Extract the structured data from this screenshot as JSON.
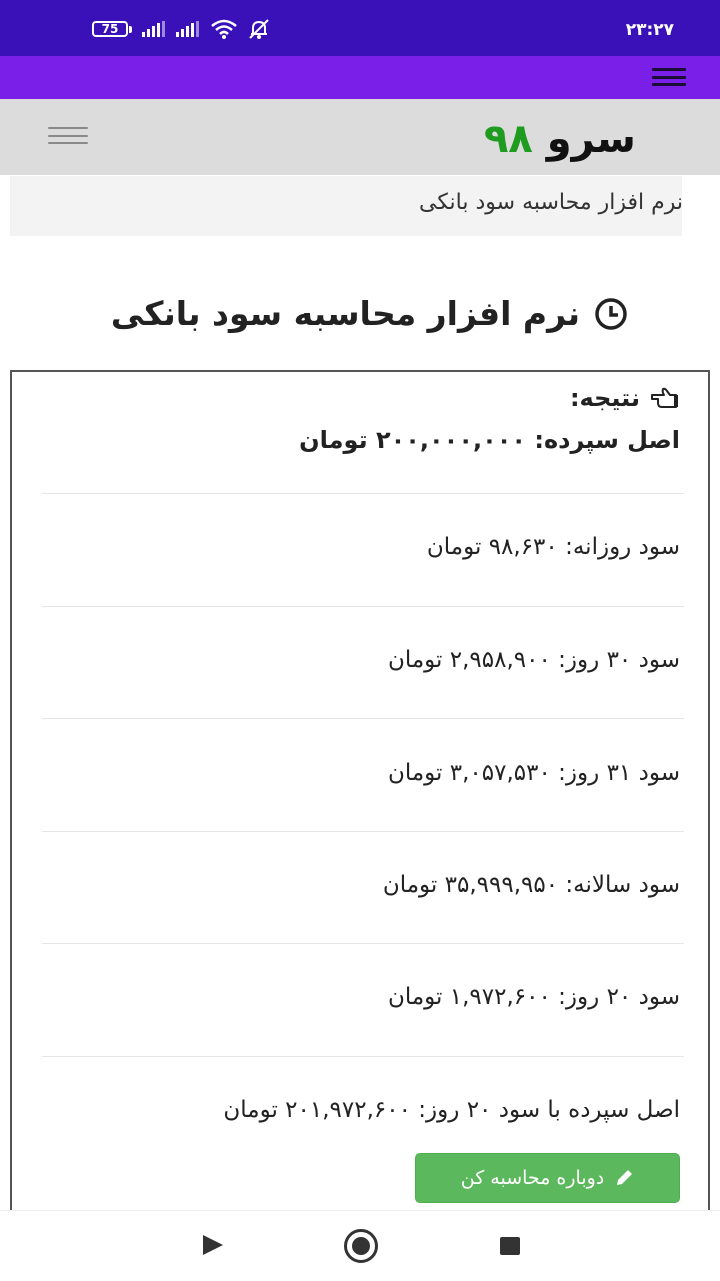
{
  "status_bar": {
    "time": "۲۳:۲۷",
    "battery_level": "75",
    "icons": [
      "battery-icon",
      "signal-icon",
      "signal-icon",
      "wifi-icon",
      "notifications-muted-icon"
    ]
  },
  "header": {
    "logo_word": "سرو",
    "logo_number": "۹۸",
    "logo_number_color": "#1f9b1f"
  },
  "breadcrumb": {
    "text": "نرم افزار محاسبه سود بانکی"
  },
  "page": {
    "title": "نرم افزار محاسبه سود بانکی"
  },
  "result": {
    "label": "نتیجه:",
    "principal": "اصل سپرده: ۲۰۰,۰۰۰,۰۰۰ تومان",
    "rows": [
      "سود روزانه: ۹۸,۶۳۰ تومان",
      "سود ۳۰ روز: ۲,۹۵۸,۹۰۰ تومان",
      "سود ۳۱ روز: ۳,۰۵۷,۵۳۰ تومان",
      "سود سالانه: ۳۵,۹۹۹,۹۵۰ تومان",
      "سود ۲۰ روز: ۱,۹۷۲,۶۰۰ تومان",
      "اصل سپرده با سود ۲۰ روز: ۲۰۱,۹۷۲,۶۰۰ تومان"
    ],
    "recalc_label": "دوباره محاسبه کن",
    "button_color": "#5cb85c"
  },
  "colors": {
    "status_bar": "#3a10b8",
    "nav_bar": "#7a1fe8",
    "header_bg": "#dcdcdc"
  }
}
